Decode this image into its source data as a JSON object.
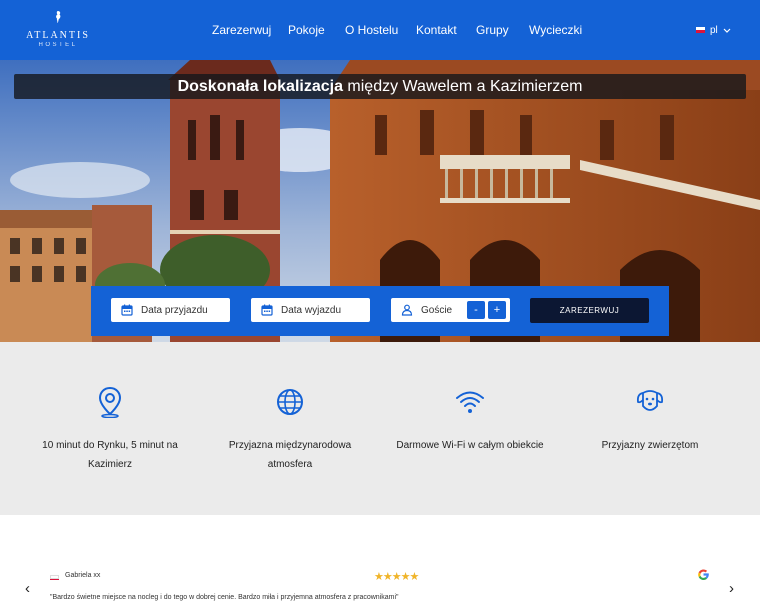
{
  "header": {
    "logo_name": "ATLANTIS",
    "logo_sub": "HOSTEL",
    "nav": [
      "Zarezerwuj",
      "Pokoje",
      "O Hostelu",
      "Kontakt",
      "Grupy",
      "Wycieczki"
    ],
    "language": "pl"
  },
  "hero": {
    "headline_bold": "Doskonała lokalizacja",
    "headline_rest": " między Wawelem a Kazimierzem"
  },
  "booking": {
    "arrival_placeholder": "Data przyjazdu",
    "departure_placeholder": "Data wyjazdu",
    "guests_label": "Goście",
    "minus": "-",
    "plus": "+",
    "reserve_label": "ZAREZERWUJ"
  },
  "features": [
    {
      "icon": "map-pin-icon",
      "text": "10 minut do Rynku, 5 minut na Kazimierz"
    },
    {
      "icon": "globe-icon",
      "text": "Przyjazna międzynarodowa atmosfera"
    },
    {
      "icon": "wifi-icon",
      "text": "Darmowe Wi-Fi w całym obiekcie"
    },
    {
      "icon": "dog-icon",
      "text": "Przyjazny zwierzętom"
    }
  ],
  "review": {
    "author": "Gabriela xx",
    "rating": 5,
    "stars": "★★★★★",
    "text": "\"Bardzo świetne miejsce na nocleg i do tego w dobrej cenie. Bardzo miła i przyjemna atmosfera z pracownikami\"",
    "prev": "‹",
    "next": "›"
  },
  "colors": {
    "brand_blue": "#1462d6",
    "dark_button": "#0c1733",
    "feature_bg": "#ebebeb",
    "star": "#f0b429"
  }
}
